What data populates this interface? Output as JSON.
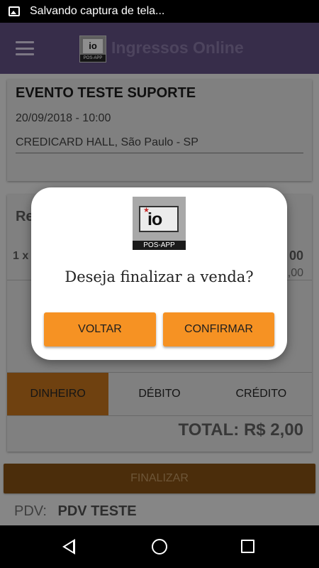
{
  "status_bar": {
    "notification": "Salvando captura de tela..."
  },
  "app_bar": {
    "title": "Ingressos Online",
    "logo_text": "io",
    "logo_sub": "POS-APP"
  },
  "event": {
    "name": "EVENTO TESTE SUPORTE",
    "datetime": "20/09/2018 - 10:00",
    "venue": "CREDICARD HALL, São Paulo - SP"
  },
  "sale": {
    "heading_partial": "Re",
    "qty_partial": "1 x",
    "price_partial_1": "00",
    "price_partial_2": ",00"
  },
  "payment": {
    "options": [
      "DINHEIRO",
      "DÉBITO",
      "CRÉDITO"
    ],
    "selected": "DINHEIRO",
    "total": "TOTAL: R$ 2,00"
  },
  "finalize_label": "FINALIZAR",
  "pdv": {
    "label": "PDV:",
    "value": "PDV TESTE"
  },
  "dialog": {
    "logo_text": "io",
    "logo_sub": "POS-APP",
    "message": "Deseja finalizar a venda?",
    "cancel_label": "VOLTAR",
    "confirm_label": "CONFIRMAR"
  },
  "colors": {
    "accent": "#f69223",
    "app_bar": "#5a4a78",
    "selected_payment": "#b36a1a"
  }
}
